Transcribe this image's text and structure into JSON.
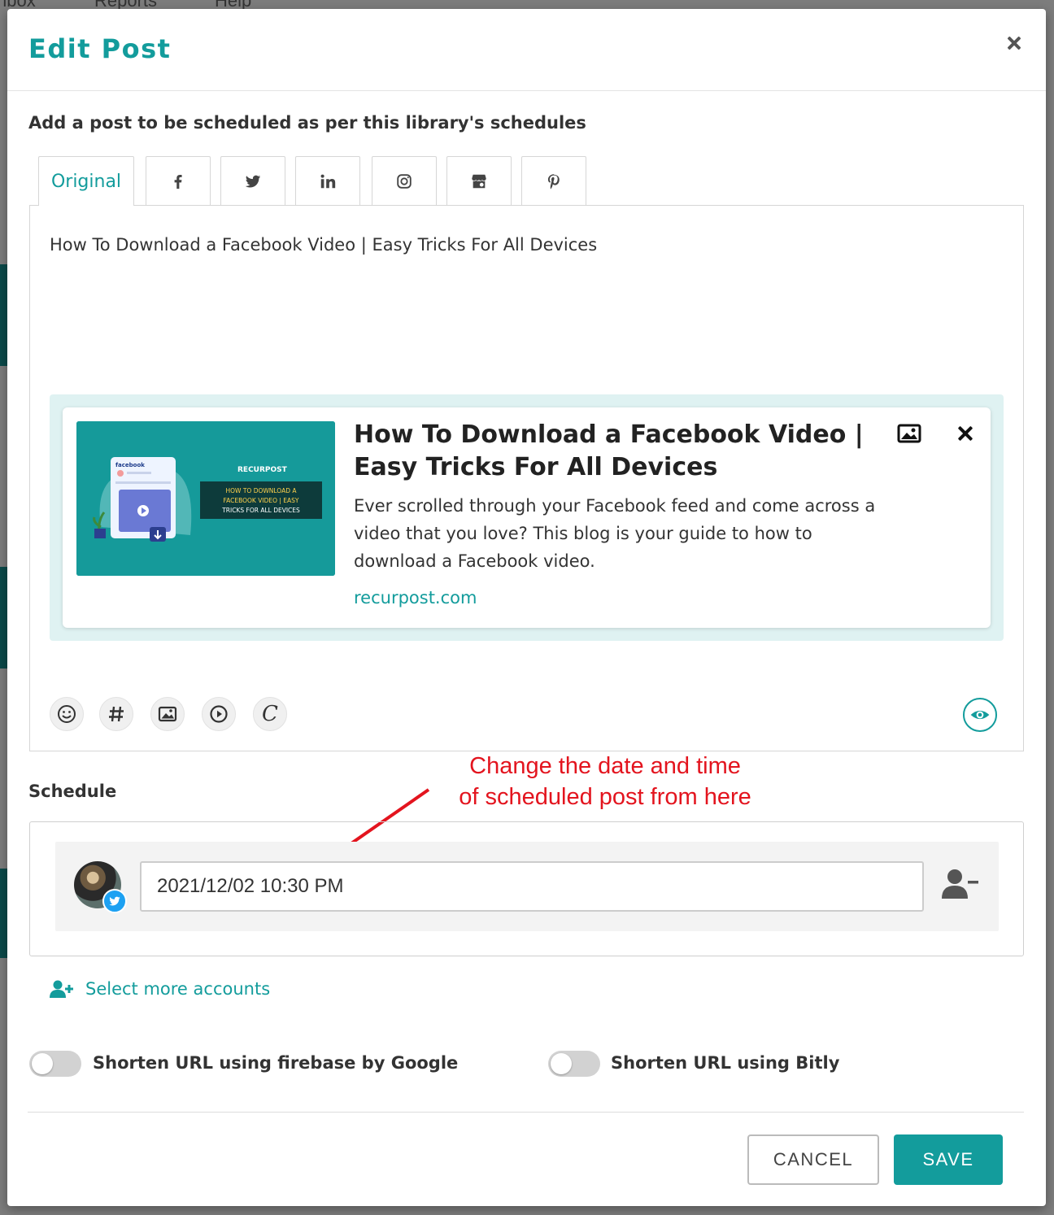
{
  "background": {
    "nav": [
      "nbox",
      "Reports",
      "Help"
    ]
  },
  "modal": {
    "title": "Edit Post",
    "subtitle": "Add a post to be scheduled as per this library's schedules"
  },
  "tabs": [
    {
      "label": "Original",
      "icon": null
    },
    {
      "label": "",
      "icon": "facebook-icon"
    },
    {
      "label": "",
      "icon": "twitter-icon"
    },
    {
      "label": "",
      "icon": "linkedin-icon"
    },
    {
      "label": "",
      "icon": "instagram-icon"
    },
    {
      "label": "",
      "icon": "google-my-business-icon"
    },
    {
      "label": "",
      "icon": "pinterest-icon"
    }
  ],
  "post": {
    "text": "How To Download a Facebook Video | Easy Tricks For All Devices"
  },
  "link_preview": {
    "title": "How To Download a Facebook Video | Easy Tricks For All Devices",
    "description": "Ever scrolled through your Facebook feed and come across a video that you love? This blog is your guide to how to download a Facebook video.",
    "domain": "recurpost.com",
    "thumbnail": {
      "brand": "RECURPOST",
      "headline_line1": "HOW TO DOWNLOAD A",
      "headline_line2": "FACEBOOK VIDEO | EASY",
      "headline_line3": "TRICKS FOR ALL DEVICES",
      "mock_app": "facebook"
    }
  },
  "toolbar": {
    "tools": [
      "emoji-icon",
      "hashtag-icon",
      "image-icon",
      "video-icon",
      "canva-icon"
    ],
    "canva_glyph": "C"
  },
  "annotation": {
    "line1": "Change the date and time",
    "line2": "of scheduled post from here"
  },
  "schedule": {
    "label": "Schedule",
    "datetime": "2021/12/02 10:30 PM",
    "network": "twitter"
  },
  "select_more": {
    "label": "Select more accounts"
  },
  "toggles": {
    "firebase_label": "Shorten URL using firebase by Google",
    "firebase_on": false,
    "bitly_label": "Shorten URL using Bitly",
    "bitly_on": false
  },
  "buttons": {
    "cancel": "CANCEL",
    "save": "SAVE"
  },
  "colors": {
    "accent": "#139c9c",
    "annotation": "#e3141e",
    "twitter": "#1da1f2"
  }
}
